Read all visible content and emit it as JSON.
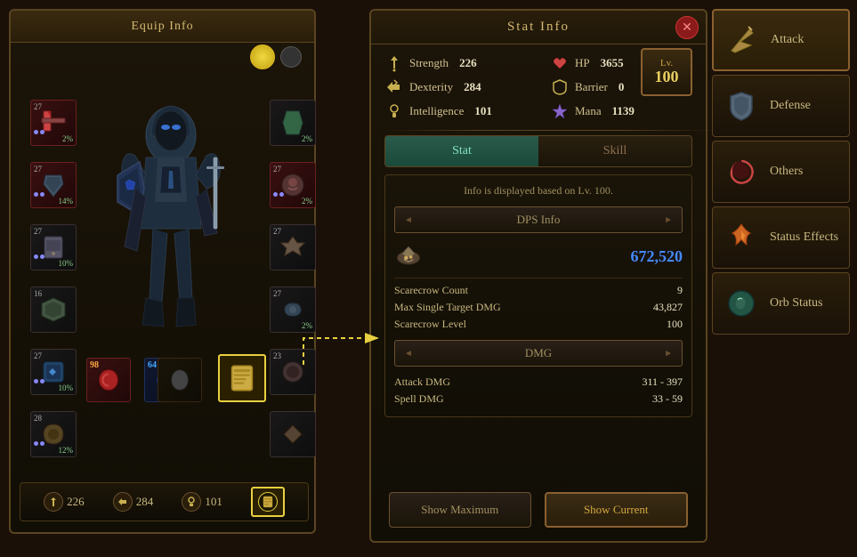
{
  "equip": {
    "title": "Equip Info",
    "slots": {
      "left": [
        {
          "level": 27,
          "bonus": "2%",
          "type": "red"
        },
        {
          "level": 27,
          "bonus": "14%",
          "type": "red"
        },
        {
          "level": 27,
          "bonus": "10%",
          "type": "dark"
        },
        {
          "level": 16,
          "bonus": "",
          "type": "dark"
        },
        {
          "level": 27,
          "bonus": "10%",
          "type": "dark"
        },
        {
          "level": 28,
          "bonus": "12%",
          "type": "dark"
        }
      ],
      "right": [
        {
          "level": "",
          "bonus": "2%",
          "type": "dark"
        },
        {
          "level": 27,
          "bonus": "2%",
          "type": "red"
        },
        {
          "level": 27,
          "bonus": "",
          "type": "dark"
        },
        {
          "level": 27,
          "bonus": "2%",
          "type": "dark"
        },
        {
          "level": 23,
          "bonus": "",
          "type": "dark"
        },
        {
          "level": "",
          "bonus": "",
          "type": "dark"
        }
      ],
      "bottom": [
        {
          "level": 98,
          "bonus": "",
          "type": "red"
        },
        {
          "level": 64,
          "bonus": "",
          "type": "blue"
        }
      ]
    }
  },
  "bottom_stats": {
    "strength": {
      "label": "226",
      "icon": "✊"
    },
    "dexterity": {
      "label": "284",
      "icon": "⚡"
    },
    "intelligence": {
      "label": "101",
      "icon": "👁"
    },
    "special": {
      "label": "",
      "icon": "📖",
      "highlighted": true
    }
  },
  "stat_info": {
    "title": "Stat Info",
    "close": "✕",
    "level": {
      "label": "Lv.",
      "value": "100"
    },
    "stats": {
      "strength": {
        "label": "Strength",
        "value": "226"
      },
      "dexterity": {
        "label": "Dexterity",
        "value": "284"
      },
      "intelligence": {
        "label": "Intelligence",
        "value": "101"
      },
      "hp": {
        "label": "HP",
        "value": "3655"
      },
      "barrier": {
        "label": "Barrier",
        "value": "0"
      },
      "mana": {
        "label": "Mana",
        "value": "1139"
      }
    },
    "tabs": {
      "stat": "Stat",
      "skill": "Skill"
    },
    "active_tab": "Stat",
    "note": "Info is displayed based on Lv. 100.",
    "dps_btn": "DPS Info",
    "dps_value": "672,520",
    "scarecrow": {
      "count_label": "Scarecrow Count",
      "count_value": "9",
      "max_dmg_label": "Max Single Target DMG",
      "max_dmg_value": "43,827",
      "level_label": "Scarecrow Level",
      "level_value": "100"
    },
    "dmg_btn": "DMG",
    "dmg": {
      "attack_label": "Attack DMG",
      "attack_value": "311 - 397",
      "spell_label": "Spell DMG",
      "spell_value": "33 - 59"
    },
    "buttons": {
      "show_maximum": "Show Maximum",
      "show_current": "Show Current"
    }
  },
  "right_panel": {
    "buttons": [
      {
        "label": "Attack",
        "icon": "⚔"
      },
      {
        "label": "Defense",
        "icon": "🛡"
      },
      {
        "label": "Others",
        "icon": "❤"
      },
      {
        "label": "Status Effects",
        "icon": "🔥"
      },
      {
        "label": "Orb Status",
        "icon": "🌀"
      }
    ]
  },
  "icons": {
    "strength_icon": "✊",
    "dexterity_icon": "⚡",
    "intelligence_icon": "👁",
    "hp_icon": "✚",
    "barrier_icon": "🛡",
    "mana_icon": "✦",
    "close_icon": "✕",
    "dps_shell_icon": "🐚"
  }
}
